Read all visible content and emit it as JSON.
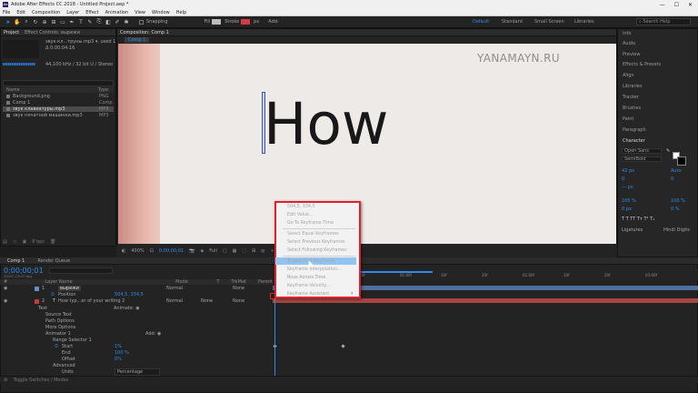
{
  "titlebar": {
    "title": "Adobe After Effects CC 2018 - Untitled Project.aep *",
    "logo": "Ae",
    "min": "—",
    "max": "☐",
    "close": "✕"
  },
  "menubar": {
    "items": [
      "File",
      "Edit",
      "Composition",
      "Layer",
      "Effect",
      "Animation",
      "View",
      "Window",
      "Help"
    ]
  },
  "toolbar": {
    "snapping": "Snapping",
    "fill_label": "Fill",
    "stroke_label": "Stroke",
    "stroke_px": "px",
    "add_label": "Add:",
    "accent_color": "#2d8ceb"
  },
  "workspaces": {
    "items": [
      "Default",
      "Standard",
      "Small Screen",
      "Libraries"
    ],
    "active": "Default",
    "search_placeholder": "Search Help"
  },
  "project": {
    "tabs": [
      "Project",
      "Effect Controls: вырежи"
    ],
    "selected_name": "звук кл...труны.mp3 ▾, used 1 time",
    "selected_duration": "Δ 0:00:04:16",
    "selected_info": "44,100 kHz / 32 bit U / Stereo",
    "columns": {
      "name": "Name",
      "type": "Type"
    },
    "items": [
      {
        "name": "Background.png",
        "type": "PNG",
        "selected": false
      },
      {
        "name": "Comp 1",
        "type": "Comp",
        "selected": false
      },
      {
        "name": "звук клавиатуры.mp3",
        "type": "MP3",
        "selected": true
      },
      {
        "name": "звук печатной машинки.mp3",
        "type": "MP3",
        "selected": false
      }
    ],
    "bottom_bpc": "8 bpc"
  },
  "viewer": {
    "tabs": [
      "Composition: Comp 1",
      "Comp 1"
    ],
    "watermark": "YANAMAYN.RU",
    "text": "How",
    "zoom": "400%",
    "timecode": "0;00;00;01",
    "resolution": "Full",
    "offset": "+0.0"
  },
  "rightpanel": {
    "items": [
      "Info",
      "Audio",
      "Preview",
      "Effects & Presets",
      "Align",
      "Libraries",
      "Tracker",
      "Brushes",
      "Paint",
      "Paragraph",
      "Character"
    ],
    "character": {
      "font": "Open Sans",
      "style": "SemiBold",
      "size": "42 px",
      "leading": "Auto",
      "kerning": "0",
      "tracking": "0",
      "stroke_px": "— px",
      "vscale": "100 %",
      "hscale": "100 %",
      "baseline": "0 px",
      "tsume": "0 %",
      "ligatures": "Ligatures",
      "hindi": "Hindi Digits"
    }
  },
  "timeline": {
    "tabs": [
      "Comp 1",
      "Render Queue"
    ],
    "timecode": "0;00;00;01",
    "timecode_sub": "00001 (29.97 fps)",
    "columns": [
      "#",
      "Layer Name",
      "Mode",
      "T",
      "TrkMat",
      "Parent"
    ],
    "layers": [
      {
        "num": "1",
        "name": "вырежи",
        "mode": "Normal",
        "parent": "None"
      },
      {
        "num": "",
        "name": "Position",
        "value": "504,5, 334,5"
      },
      {
        "num": "2",
        "name": "How typ...er of your writing 2",
        "mode": "Normal",
        "trkmat": "None",
        "parent": "None"
      }
    ],
    "props": [
      {
        "indent": 1,
        "name": "Text",
        "value": ""
      },
      {
        "indent": 2,
        "name": "Source Text",
        "value": ""
      },
      {
        "indent": 2,
        "name": "Path Options",
        "value": ""
      },
      {
        "indent": 2,
        "name": "More Options",
        "value": ""
      },
      {
        "indent": 2,
        "name": "Animator 1",
        "value": "Add: ◉"
      },
      {
        "indent": 3,
        "name": "Range Selector 1",
        "value": ""
      },
      {
        "indent": 4,
        "name": "Start",
        "value": "1%"
      },
      {
        "indent": 4,
        "name": "End",
        "value": "100 %"
      },
      {
        "indent": 4,
        "name": "Offset",
        "value": "0%"
      },
      {
        "indent": 3,
        "name": "Advanced",
        "value": ""
      },
      {
        "indent": 4,
        "name": "Units",
        "value": "Percentage"
      }
    ],
    "animate_label": "Animate: ◉",
    "ruler_ticks": [
      "00:00f",
      "10f",
      "20f",
      "01:00f",
      "10f",
      "20f",
      "02:00f",
      "10f",
      "20f",
      "03:00f"
    ],
    "bottom": "Toggle Switches / Modes"
  },
  "context_menu": {
    "items": [
      {
        "label": "504,5, 334,5",
        "state": "normal"
      },
      {
        "label": "Edit Value...",
        "state": "normal"
      },
      {
        "label": "Go To Keyframe Time",
        "state": "normal"
      },
      {
        "sep": true
      },
      {
        "label": "Select Equal Keyframes",
        "state": "normal"
      },
      {
        "label": "Select Previous Keyframes",
        "state": "normal"
      },
      {
        "label": "Select Following Keyframes",
        "state": "normal"
      },
      {
        "sep": true
      },
      {
        "label": "Toggle Hold Keyframe",
        "state": "highlight"
      },
      {
        "label": "Keyframe Interpolation...",
        "state": "normal"
      },
      {
        "label": "Rove Across Time",
        "state": "disabled"
      },
      {
        "label": "Keyframe Velocity...",
        "state": "normal"
      },
      {
        "label": "Keyframe Assistant",
        "state": "normal",
        "submenu": "›"
      }
    ]
  }
}
